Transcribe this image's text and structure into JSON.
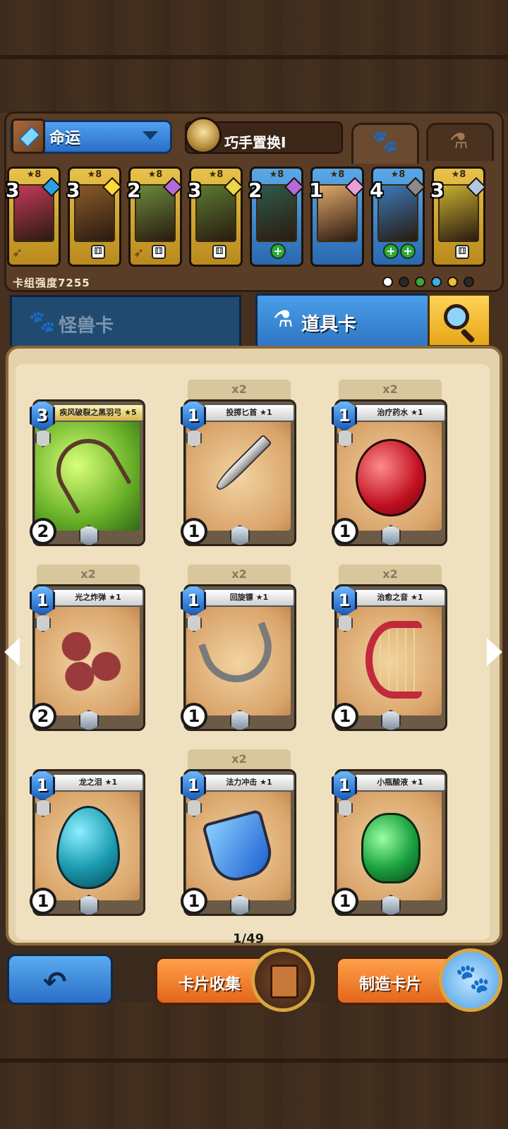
{
  "deck": {
    "name": "命运",
    "swap_label": "巧手置换Ⅰ",
    "power_label": "卡组强度7255",
    "mini_cards": [
      {
        "level": "3",
        "stars": "★8",
        "frame": "gold",
        "gem": "#2a9ee8",
        "art": "#c23a5a",
        "bottom": "bow"
      },
      {
        "level": "3",
        "stars": "★8",
        "frame": "gold",
        "gem": "#ffd83a",
        "art": "#8a5a2a",
        "bottom": "die"
      },
      {
        "level": "2",
        "stars": "★8",
        "frame": "gold",
        "gem": "#b46ad8",
        "art": "#6a8a3a",
        "bottom": "bow-die"
      },
      {
        "level": "3",
        "stars": "★8",
        "frame": "gold",
        "gem": "#e8d84a",
        "art": "#5a7a30",
        "bottom": "die"
      },
      {
        "level": "2",
        "stars": "★8",
        "frame": "blue",
        "gem": "#b46ad8",
        "art": "#2f5a4a",
        "bottom": "plus"
      },
      {
        "level": "1",
        "stars": "★8",
        "frame": "blue",
        "gem": "#e8a0d8",
        "art": "#e0a86a",
        "bottom": "none"
      },
      {
        "level": "4",
        "stars": "★8",
        "frame": "blue",
        "gem": "#8a8a8a",
        "art": "#3a7ab8",
        "bottom": "plus2"
      },
      {
        "level": "3",
        "stars": "★8",
        "frame": "gold",
        "gem": "#b0c8e0",
        "art": "#c8b030",
        "bottom": "die"
      }
    ],
    "element_colors": [
      "#ffffff",
      "#2a2a2a",
      "#3aa83a",
      "#3ab0e8",
      "#f0c030",
      "#2a2a2a"
    ]
  },
  "tabs": {
    "monster": "怪兽卡",
    "item": "道具卡",
    "search_icon": "search-icon"
  },
  "cards": [
    {
      "title": "疾风破裂之黑羽弓 ★5",
      "cost": "3",
      "qty": "2",
      "dup": "",
      "green": true,
      "gold_banner": true,
      "art": "bow"
    },
    {
      "title": "投掷匕首 ★1",
      "cost": "1",
      "qty": "1",
      "dup": "x2",
      "green": false,
      "gold_banner": false,
      "art": "dagger"
    },
    {
      "title": "治疗药水 ★1",
      "cost": "1",
      "qty": "1",
      "dup": "x2",
      "green": false,
      "gold_banner": false,
      "art": "potion"
    },
    {
      "title": "光之炸弹 ★1",
      "cost": "1",
      "qty": "2",
      "dup": "x2",
      "green": false,
      "gold_banner": false,
      "art": "bombs"
    },
    {
      "title": "回旋镖 ★1",
      "cost": "1",
      "qty": "1",
      "dup": "x2",
      "green": false,
      "gold_banner": false,
      "art": "boomerang"
    },
    {
      "title": "治愈之音 ★1",
      "cost": "1",
      "qty": "1",
      "dup": "x2",
      "green": false,
      "gold_banner": false,
      "art": "harp"
    },
    {
      "title": "龙之泪 ★1",
      "cost": "1",
      "qty": "1",
      "dup": "",
      "green": false,
      "gold_banner": false,
      "art": "egg"
    },
    {
      "title": "法力冲击 ★1",
      "cost": "1",
      "qty": "1",
      "dup": "x2",
      "green": false,
      "gold_banner": false,
      "art": "mana"
    },
    {
      "title": "小瓶酸液 ★1",
      "cost": "1",
      "qty": "1",
      "dup": "",
      "green": false,
      "gold_banner": false,
      "art": "acid"
    }
  ],
  "pagination": {
    "label": "1/49"
  },
  "bottom": {
    "back_icon": "undo-arrow-icon",
    "collection_label": "卡片收集",
    "craft_label": "制造卡片"
  }
}
